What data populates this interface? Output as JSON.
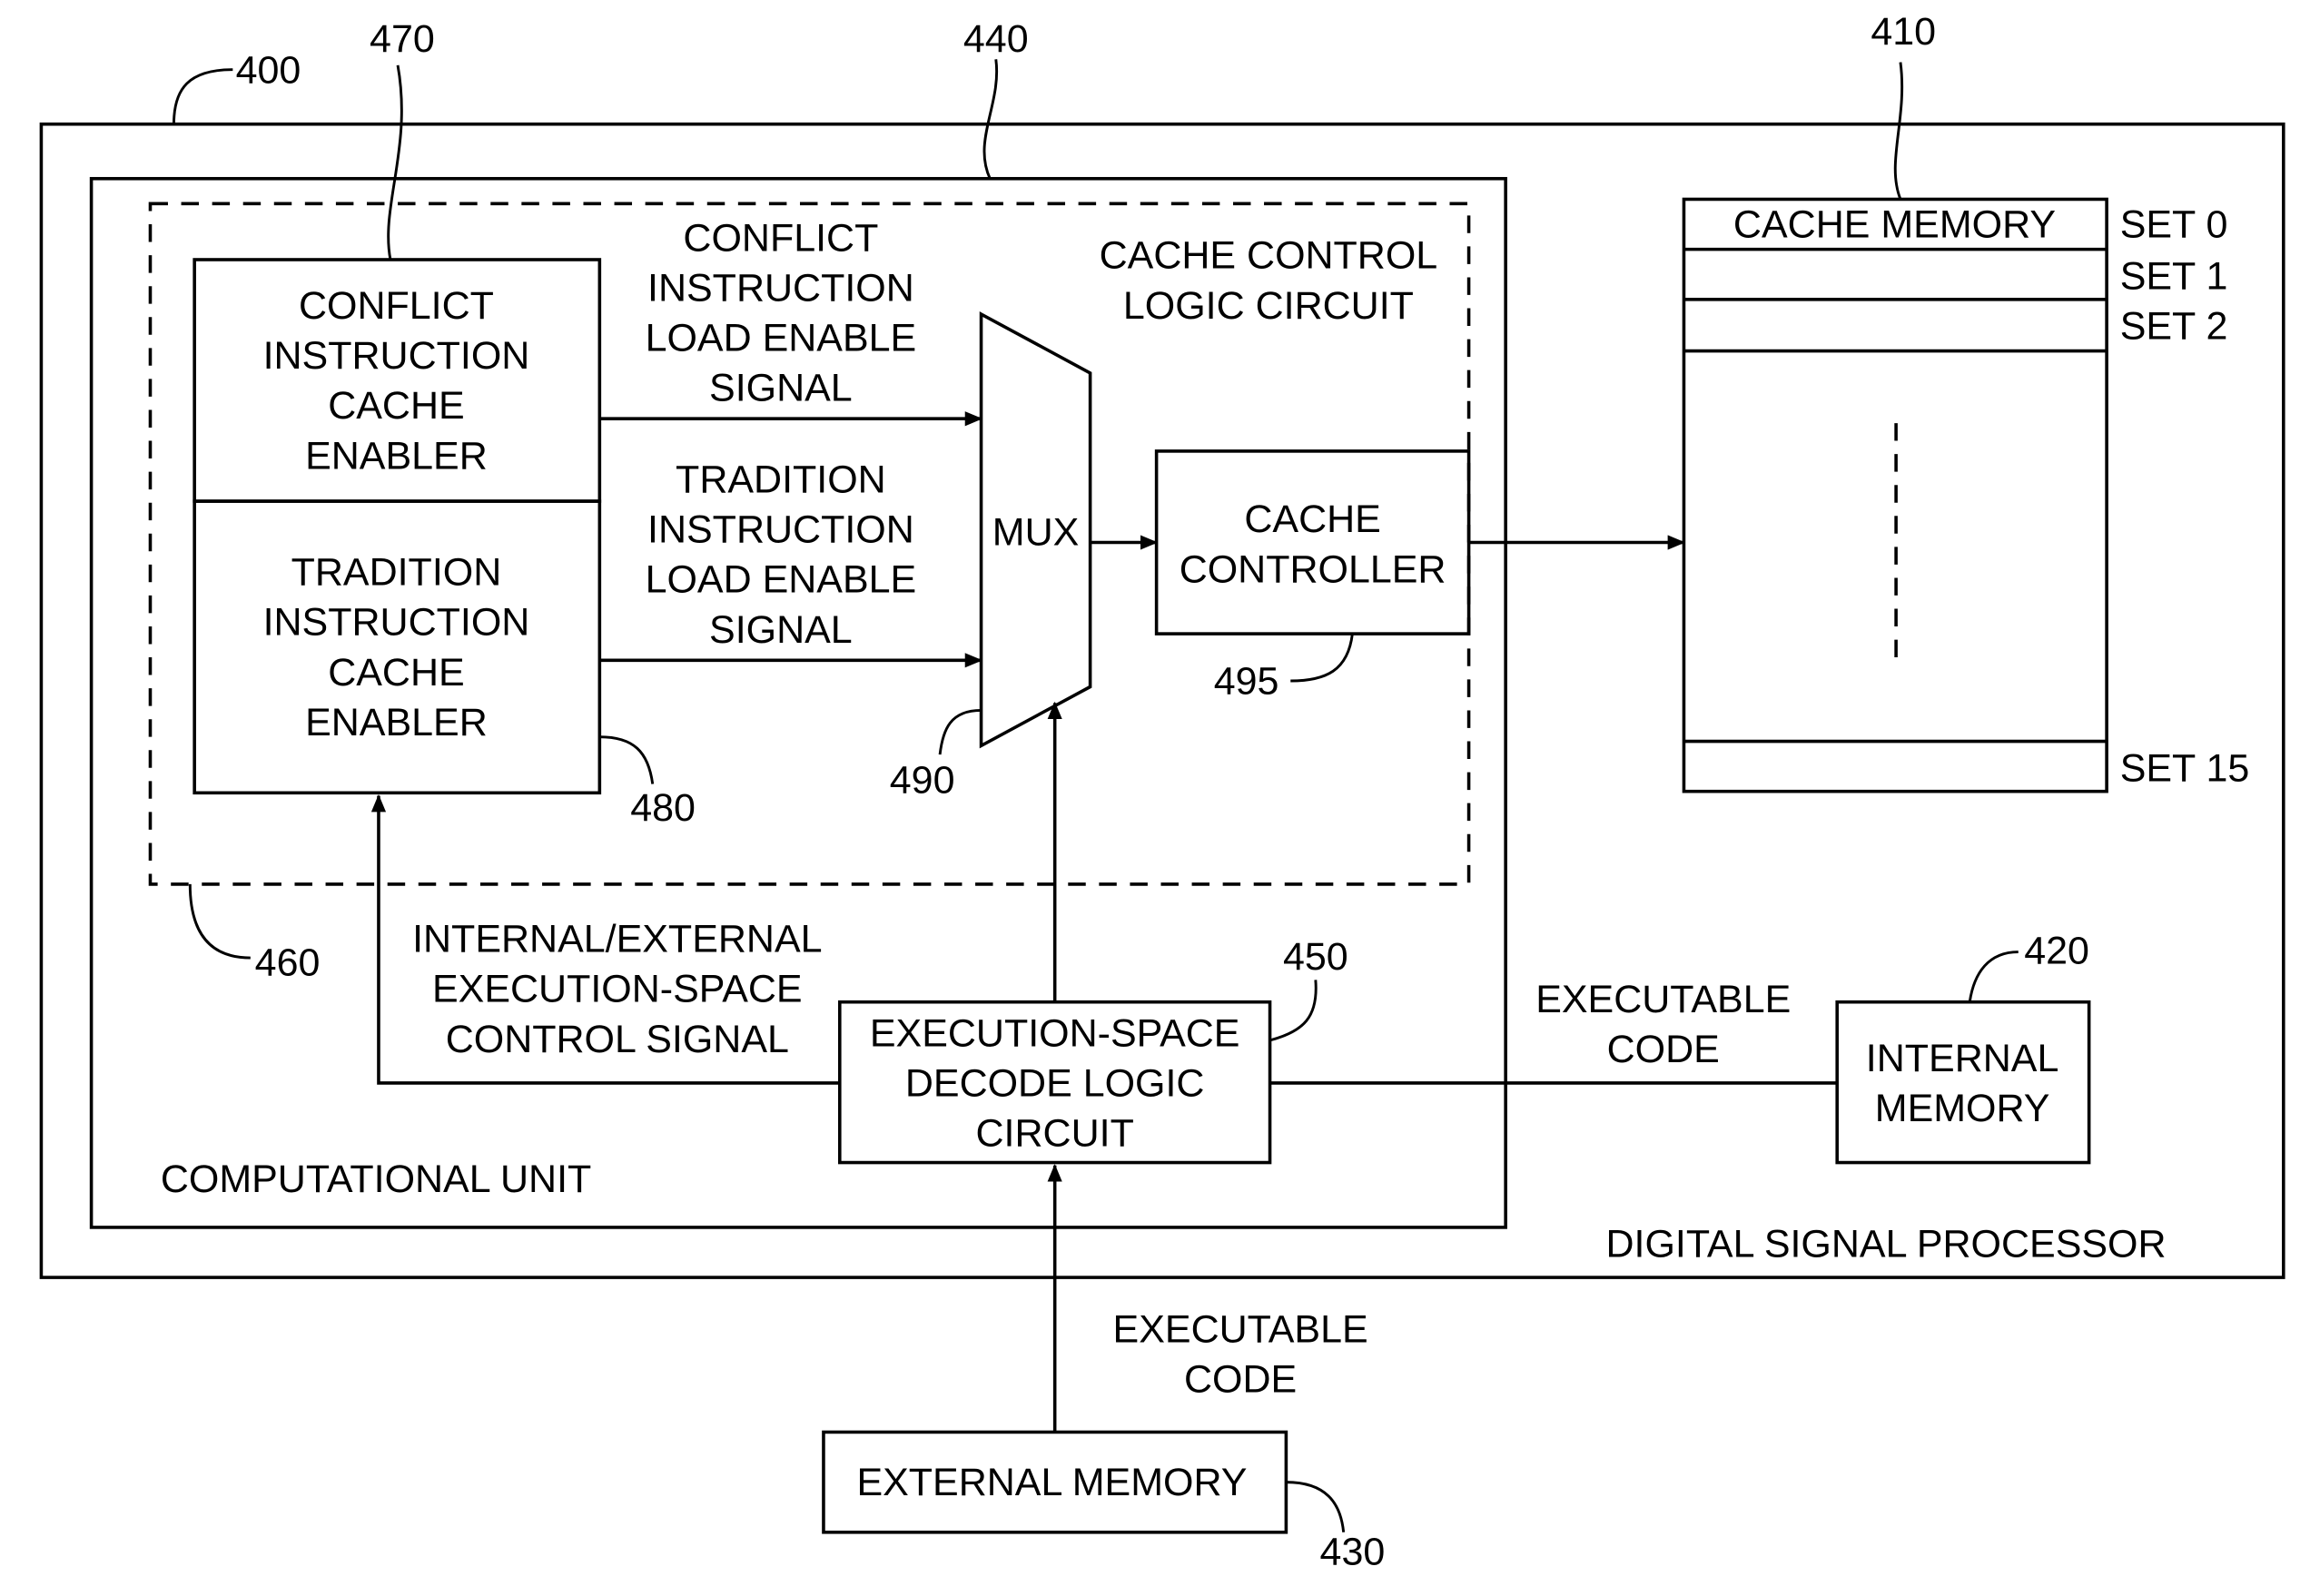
{
  "diagram": {
    "ref_labels": {
      "dsp": "400",
      "cache_memory": "410",
      "internal_memory": "420",
      "external_memory": "430",
      "computational_unit": "440",
      "decode_logic": "450",
      "cache_control_logic": "460",
      "conflict_enabler": "470",
      "tradition_enabler": "480",
      "mux": "490",
      "cache_controller": "495"
    },
    "dsp_label": "DIGITAL SIGNAL PROCESSOR",
    "computational_unit_label": "COMPUTATIONAL UNIT",
    "cache_control_label": [
      "CACHE CONTROL",
      "LOGIC CIRCUIT"
    ],
    "conflict_enabler_label": [
      "CONFLICT",
      "INSTRUCTION",
      "CACHE",
      "ENABLER"
    ],
    "tradition_enabler_label": [
      "TRADITION",
      "INSTRUCTION",
      "CACHE",
      "ENABLER"
    ],
    "conflict_signal_label": [
      "CONFLICT",
      "INSTRUCTION",
      "LOAD ENABLE",
      "SIGNAL"
    ],
    "tradition_signal_label": [
      "TRADITION",
      "INSTRUCTION",
      "LOAD ENABLE",
      "SIGNAL"
    ],
    "mux_label": "MUX",
    "cache_controller_label": [
      "CACHE",
      "CONTROLLER"
    ],
    "cache_memory": {
      "title": "CACHE MEMORY",
      "sets": [
        "SET 0",
        "SET 1",
        "SET 2",
        "SET 15"
      ]
    },
    "control_signal_label": [
      "INTERNAL/EXTERNAL",
      "EXECUTION-SPACE",
      "CONTROL SIGNAL"
    ],
    "decode_logic_label": [
      "EXECUTION-SPACE",
      "DECODE LOGIC",
      "CIRCUIT"
    ],
    "internal_code_label": [
      "EXECUTABLE",
      "CODE"
    ],
    "internal_memory_label": [
      "INTERNAL",
      "MEMORY"
    ],
    "external_code_label": [
      "EXECUTABLE",
      "CODE"
    ],
    "external_memory_label": "EXTERNAL MEMORY"
  }
}
